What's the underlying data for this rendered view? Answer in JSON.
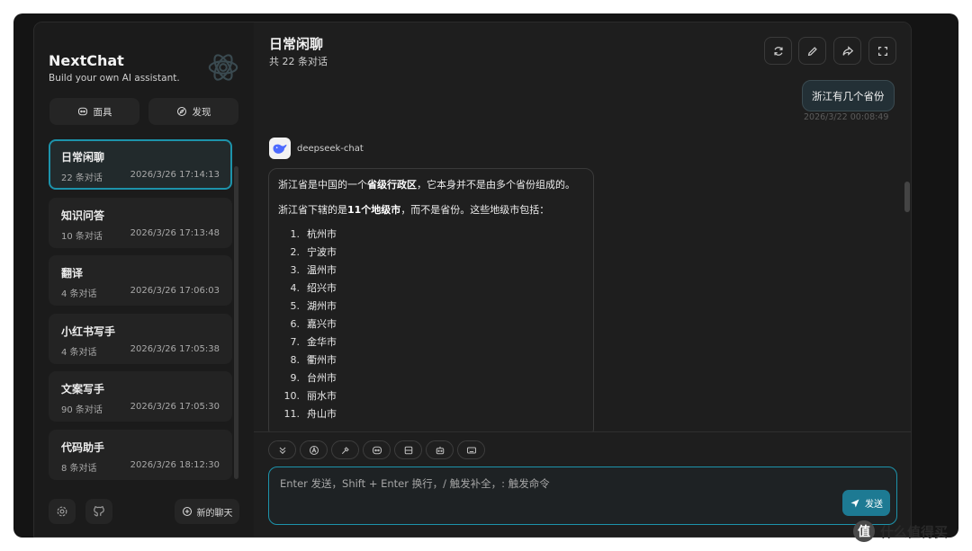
{
  "sidebar": {
    "app_title": "NextChat",
    "app_subtitle": "Build your own AI assistant.",
    "buttons": {
      "mask": "面具",
      "discover": "发现"
    },
    "sessions": [
      {
        "name": "日常闲聊",
        "count": "22 条对话",
        "time": "2026/3/26 17:14:13",
        "active": true
      },
      {
        "name": "知识问答",
        "count": "10 条对话",
        "time": "2026/3/26 17:13:48"
      },
      {
        "name": "翻译",
        "count": "4 条对话",
        "time": "2026/3/26 17:06:03"
      },
      {
        "name": "小红书写手",
        "count": "4 条对话",
        "time": "2026/3/26 17:05:38"
      },
      {
        "name": "文案写手",
        "count": "90 条对话",
        "time": "2026/3/26 17:05:30"
      },
      {
        "name": "代码助手",
        "count": "8 条对话",
        "time": "2026/3/26 18:12:30"
      }
    ],
    "new_chat": "新的聊天"
  },
  "header": {
    "title": "日常闲聊",
    "subtitle": "共 22 条对话"
  },
  "messages": {
    "user_text": "浙江有几个省份",
    "user_time": "2026/3/22 00:08:49",
    "bot_name": "deepseek-chat",
    "bot_p1_a": "浙江省是中国的一个",
    "bot_p1_b": "省级行政区",
    "bot_p1_c": "，它本身并不是由多个省份组成的。",
    "bot_p2_a": "浙江省下辖的是",
    "bot_p2_b": "11个地级市",
    "bot_p2_c": "，而不是省份。这些地级市包括：",
    "cities": [
      "杭州市",
      "宁波市",
      "温州市",
      "绍兴市",
      "湖州市",
      "嘉兴市",
      "金华市",
      "衢州市",
      "台州市",
      "丽水市",
      "舟山市"
    ]
  },
  "input": {
    "placeholder": "Enter 发送，Shift + Enter 换行，/ 触发补全，: 触发命令",
    "send_label": "发送"
  },
  "watermark": {
    "badge": "值",
    "text": "什么值得买"
  },
  "colors": {
    "accent": "#1d93ab",
    "send": "#1d7a93",
    "background": "#1e1e1e"
  }
}
